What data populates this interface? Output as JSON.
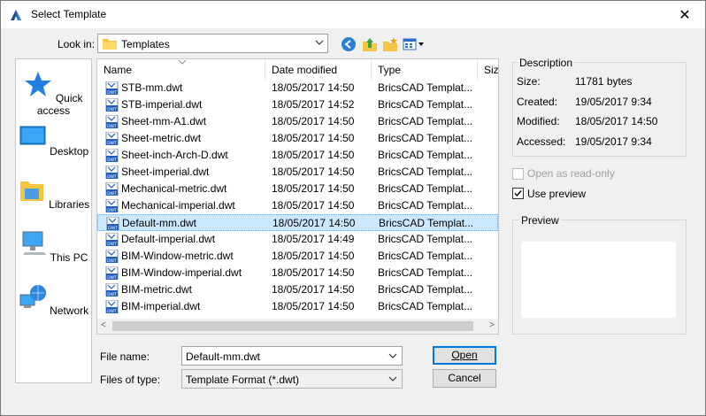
{
  "window": {
    "title": "Select Template",
    "close": "✕"
  },
  "lookin": {
    "label": "Look in:",
    "value": "Templates"
  },
  "places": [
    {
      "label": "Quick access"
    },
    {
      "label": "Desktop"
    },
    {
      "label": "Libraries"
    },
    {
      "label": "This PC"
    },
    {
      "label": "Network"
    }
  ],
  "columns": {
    "name": "Name",
    "date": "Date modified",
    "type": "Type",
    "size": "Size"
  },
  "files": [
    {
      "name": "STB-mm.dwt",
      "date": "18/05/2017 14:50",
      "type": "BricsCAD Templat..."
    },
    {
      "name": "STB-imperial.dwt",
      "date": "18/05/2017 14:52",
      "type": "BricsCAD Templat..."
    },
    {
      "name": "Sheet-mm-A1.dwt",
      "date": "18/05/2017 14:50",
      "type": "BricsCAD Templat..."
    },
    {
      "name": "Sheet-metric.dwt",
      "date": "18/05/2017 14:50",
      "type": "BricsCAD Templat..."
    },
    {
      "name": "Sheet-inch-Arch-D.dwt",
      "date": "18/05/2017 14:50",
      "type": "BricsCAD Templat..."
    },
    {
      "name": "Sheet-imperial.dwt",
      "date": "18/05/2017 14:50",
      "type": "BricsCAD Templat..."
    },
    {
      "name": "Mechanical-metric.dwt",
      "date": "18/05/2017 14:50",
      "type": "BricsCAD Templat..."
    },
    {
      "name": "Mechanical-imperial.dwt",
      "date": "18/05/2017 14:50",
      "type": "BricsCAD Templat..."
    },
    {
      "name": "Default-mm.dwt",
      "date": "18/05/2017 14:50",
      "type": "BricsCAD Templat...",
      "selected": true
    },
    {
      "name": "Default-imperial.dwt",
      "date": "18/05/2017 14:49",
      "type": "BricsCAD Templat..."
    },
    {
      "name": "BIM-Window-metric.dwt",
      "date": "18/05/2017 14:50",
      "type": "BricsCAD Templat..."
    },
    {
      "name": "BIM-Window-imperial.dwt",
      "date": "18/05/2017 14:50",
      "type": "BricsCAD Templat..."
    },
    {
      "name": "BIM-metric.dwt",
      "date": "18/05/2017 14:50",
      "type": "BricsCAD Templat..."
    },
    {
      "name": "BIM-imperial.dwt",
      "date": "18/05/2017 14:50",
      "type": "BricsCAD Templat..."
    }
  ],
  "filename": {
    "label": "File name:",
    "value": "Default-mm.dwt"
  },
  "filetype": {
    "label": "Files of type:",
    "value": "Template Format (*.dwt)"
  },
  "buttons": {
    "open": "Open",
    "cancel": "Cancel"
  },
  "description": {
    "title": "Description",
    "size_label": "Size:",
    "size": "11781 bytes",
    "created_label": "Created:",
    "created": "19/05/2017 9:34",
    "modified_label": "Modified:",
    "modified": "18/05/2017 14:50",
    "accessed_label": "Accessed:",
    "accessed": "19/05/2017 9:34"
  },
  "options": {
    "readonly": "Open as read-only",
    "use_preview": "Use preview"
  },
  "preview": {
    "title": "Preview"
  },
  "icons": {
    "app": "bricscad-icon",
    "folder": "folder-icon",
    "back": "back-arrow-icon",
    "up": "up-folder-icon",
    "newfolder": "new-folder-icon",
    "views": "view-menu-icon",
    "file": "dwt-file-icon"
  },
  "colors": {
    "selection": "#cce8ff",
    "accent": "#0078d7"
  }
}
